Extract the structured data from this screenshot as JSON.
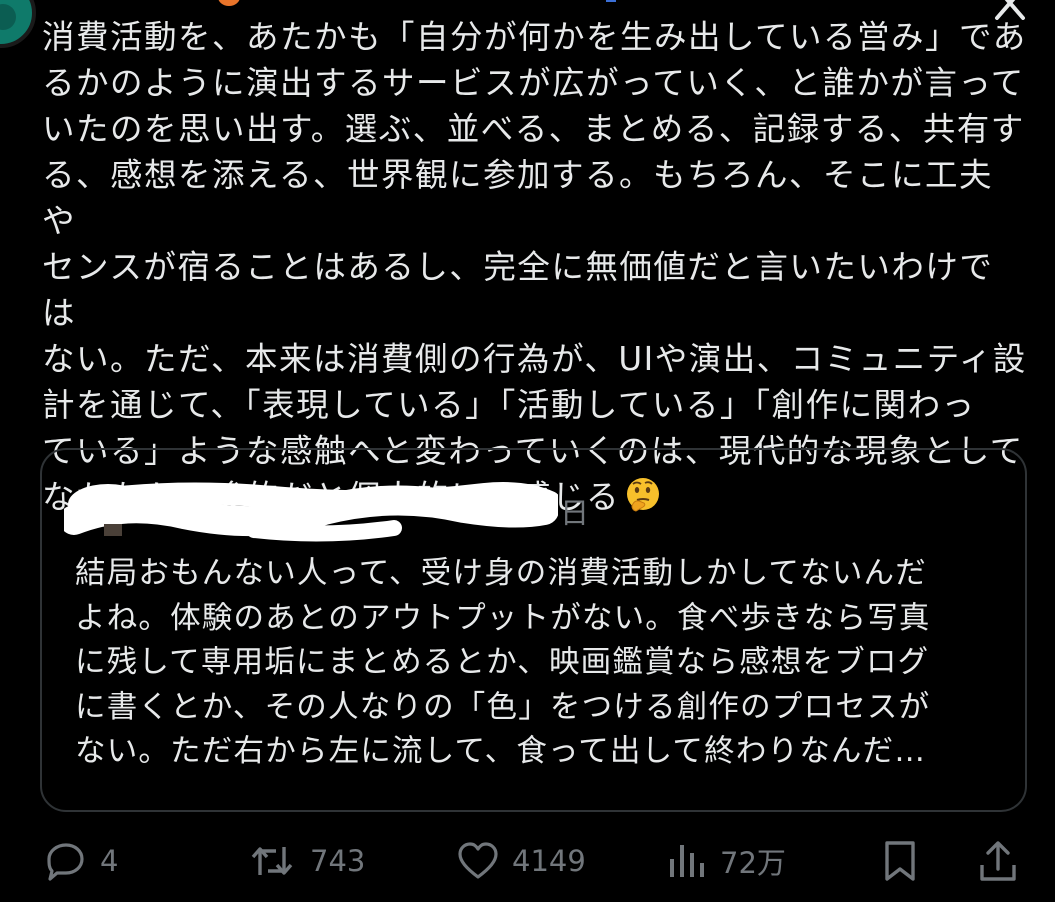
{
  "tweet": {
    "text": "消費活動を、あたかも「自分が何かを生み出している営み」であるかのように演出するサービスが広がっていく、と誰かが言っていたのを思い出す。選ぶ、並べる、まとめる、記録する、共有する、感想を添える、世界観に参加する。もちろん、そこに工夫やセンスが宿ることはあるし、完全に無価値だと言いたいわけではない。ただ、本来は消費側の行為が、UIや演出、コミュニティ設計を通じて、「表現している」「活動している」「創作に関わっている」ような感触へと変わっていくのは、現代的な現象としてなかなか示唆的だと個人的には感じる",
    "lines": [
      "消費活動を、あたかも「自分が何かを生み出している営み」であ",
      "るかのように演出するサービスが広がっていく、と誰かが言って",
      "いたのを思い出す。選ぶ、並べる、まとめる、記録する、共有す",
      "る、感想を添える、世界観に参加する。もちろん、そこに工夫や",
      "センスが宿ることはあるし、完全に無価値だと言いたいわけでは",
      "ない。ただ、本来は消費側の行為が、UIや演出、コミュニティ設",
      "計を通じて、「表現している」「活動している」「創作に関わっ",
      "ている」ような感触へと変わっていくのは、現代的な現象として",
      "なかなか示唆的だと個人的には感じる"
    ],
    "emoji": "thinking-face"
  },
  "quote": {
    "date_fragment": "日",
    "lines": [
      "結局おもんない人って、受け身の消費活動しかしてないんだ",
      "よね。体験のあとのアウトプットがない。食べ歩きなら写真",
      "に残して専用垢にまとめるとか、映画鑑賞なら感想をブログ",
      "に書くとか、その人なりの「色」をつける創作のプロセスが",
      "ない。ただ右から左に流して、食って出して終わりなんだ…"
    ]
  },
  "actions": {
    "reply": {
      "icon": "reply-icon",
      "count": "4"
    },
    "repost": {
      "icon": "repost-icon",
      "count": "743"
    },
    "like": {
      "icon": "heart-icon",
      "count": "4149"
    },
    "views": {
      "icon": "views-icon",
      "count": "72万"
    },
    "bookmark": {
      "icon": "bookmark-icon"
    },
    "share": {
      "icon": "share-icon"
    }
  },
  "colors": {
    "background": "#000000",
    "text": "#e7e9ea",
    "muted": "#71767b",
    "border": "#2f3336"
  }
}
